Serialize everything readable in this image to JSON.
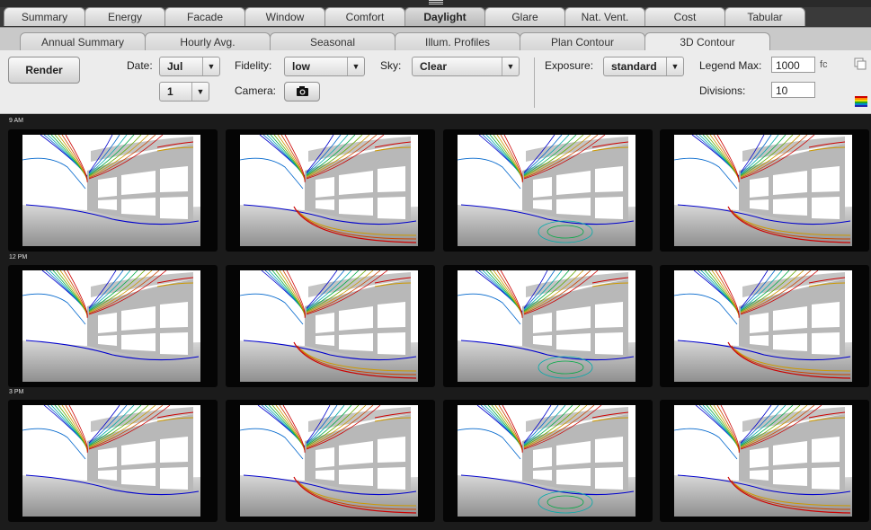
{
  "main_tabs": [
    "Summary",
    "Energy",
    "Facade",
    "Window",
    "Comfort",
    "Daylight",
    "Glare",
    "Nat. Vent.",
    "Cost",
    "Tabular"
  ],
  "active_main_tab": "Daylight",
  "sub_tabs": [
    "Annual Summary",
    "Hourly Avg.",
    "Seasonal",
    "Illum. Profiles",
    "Plan Contour",
    "3D Contour"
  ],
  "active_sub_tab": "3D Contour",
  "toolbar": {
    "render_label": "Render",
    "date_label": "Date:",
    "month_value": "Jul",
    "day_value": "1",
    "fidelity_label": "Fidelity:",
    "fidelity_value": "low",
    "camera_label": "Camera:",
    "sky_label": "Sky:",
    "sky_value": "Clear",
    "exposure_label": "Exposure:",
    "exposure_value": "standard",
    "legend_max_label": "Legend Max:",
    "legend_max_value": "1000",
    "legend_unit": "fc",
    "divisions_label": "Divisions:",
    "divisions_value": "10"
  },
  "icons": {
    "camera": "camera-icon",
    "copy": "copy-icon",
    "legend": "color-legend-icon",
    "grip": "drag-handle-icon",
    "dropdown": "chevron-down-icon"
  },
  "rows": [
    {
      "label": "9 AM"
    },
    {
      "label": "12 PM"
    },
    {
      "label": "3 PM"
    }
  ],
  "contour_colors": [
    "#0000cc",
    "#0066cc",
    "#00aaaa",
    "#00aa44",
    "#66aa00",
    "#cc9900",
    "#cc4400",
    "#cc0000"
  ]
}
